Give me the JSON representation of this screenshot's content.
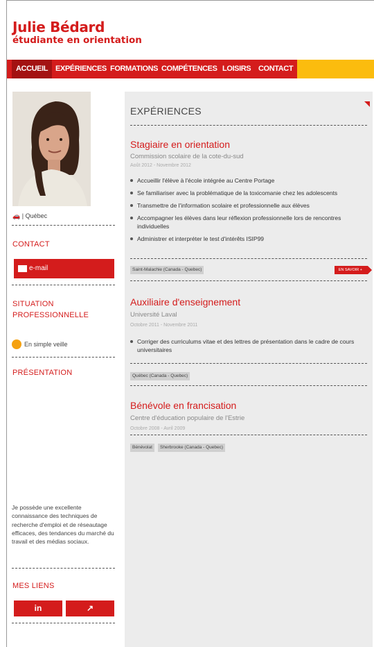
{
  "header": {
    "name": "Julie Bédard",
    "subtitle": "étudiante en orientation"
  },
  "nav": {
    "items": [
      {
        "label": "ACCUEIL"
      },
      {
        "label": "EXPÉRIENCES"
      },
      {
        "label": "FORMATIONS"
      },
      {
        "label": "COMPÉTENCES"
      },
      {
        "label": "LOISIRS"
      },
      {
        "label": "CONTACT"
      }
    ]
  },
  "sidebar": {
    "location": "Québec",
    "contact_title": "CONTACT",
    "email_label": "e-mail",
    "situation_title": "SITUATION PROFESSIONNELLE",
    "situation_status": "En simple veille",
    "situation_color": "#f5a110",
    "presentation_title": "PRÉSENTATION",
    "presentation_text": "Je possède une excellente connaissance des techniques de recherche d'emploi et de réseautage efficaces, des tendances du marché du travail et des médias sociaux.",
    "links_title": "MES LIENS",
    "links": [
      {
        "icon": "linkedin-icon",
        "label": "in"
      },
      {
        "icon": "external-link-icon",
        "label": "↗"
      }
    ]
  },
  "main": {
    "title": "EXPÉRIENCES",
    "more_label": "EN SAVOIR +",
    "jobs": [
      {
        "title": "Stagiaire en orientation",
        "org": "Commission scolaire de la cote-du-sud",
        "dates": "Août 2012 - Novembre 2012",
        "bullets": [
          "Accueillir l'élève à l'école intégrée au Centre Portage",
          "Se familiariser avec la problématique de la toxicomanie chez les adolescents",
          "Transmettre de l'information scolaire et professionnelle aux élèves",
          "Accompagner les élèves dans leur réflexion professionnelle lors de rencontres individuelles",
          "Administrer et interpréter le test d'intérêts ISIP99"
        ],
        "tags": [
          "Saint-Malachie (Canada - Quebec)"
        ]
      },
      {
        "title": "Auxiliaire d'enseignement",
        "org": "Université Laval",
        "dates": "Octobre 2011 - Novembre 2011",
        "bullets": [
          "Corriger des curriculums vitae et des lettres de présentation dans le cadre de cours universitaires"
        ],
        "tags": [
          "Québec (Canada - Quebec)"
        ]
      },
      {
        "title": "Bénévole en francisation",
        "org": "Centre d'éducation populaire de l'Estrie",
        "dates": "Octobre 2008 - Avril 2009",
        "bullets": [],
        "tags": [
          "Bénévolat",
          "Sherbrooke (Canada - Quebec)"
        ]
      }
    ]
  },
  "colors": {
    "accent": "#d41c1c",
    "nav_bg": "#fbbc0e",
    "panel": "#ececec"
  }
}
